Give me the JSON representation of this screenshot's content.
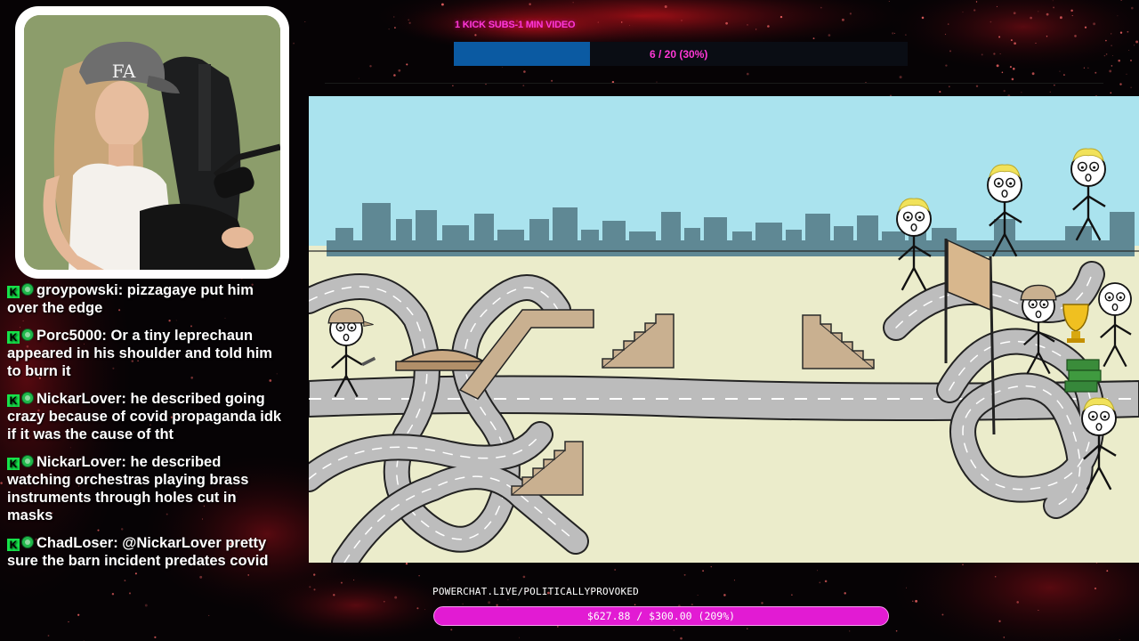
{
  "goal": {
    "title": "1 KICK SUBS-1 MIN VIDEO",
    "count_text": "6 / 20 (30%)",
    "progress_fraction": 0.3,
    "bar_color": "#0b5aa2",
    "text_color": "#ff38d6"
  },
  "donation": {
    "url": "POWERCHAT.LIVE/POLITICALLYPROVOKED",
    "amount_text": "$627.88 / $300.00 (209%)",
    "progress_fraction": 1.0,
    "bar_color": "#e21bd3"
  },
  "chat": {
    "messages": [
      {
        "username": "groypowski",
        "text": "pizzagaye put him over the edge"
      },
      {
        "username": "Porc5000",
        "text": "Or a tiny leprechaun appeared in his shoulder and told him to burn it"
      },
      {
        "username": "NickarLover",
        "text": "he described going crazy because of covid propaganda idk if it was the cause of tht"
      },
      {
        "username": "NickarLover",
        "text": "he described watching orchestras playing brass instruments through holes cut in masks"
      },
      {
        "username": "ChadLoser",
        "text": "@NickarLover pretty sure the barn incident predates covid"
      }
    ],
    "badge_icons": [
      "kick-logo-icon",
      "subscriber-badge-icon"
    ]
  },
  "webcam": {
    "cap_logo": "FA"
  },
  "colors": {
    "kick_green": "#16e34a",
    "background": "#050204",
    "accent_red": "#b3121c"
  }
}
